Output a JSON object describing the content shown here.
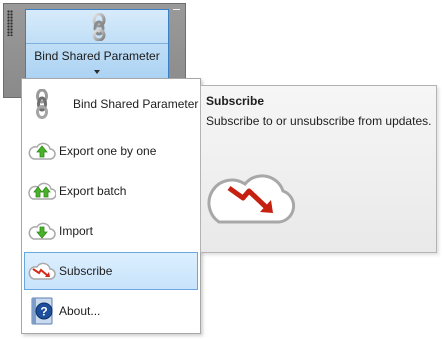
{
  "ribbon": {
    "panel_button": {
      "label": "Bind Shared Parameter",
      "icon": "chain-link-icon"
    }
  },
  "menu": {
    "items": [
      {
        "label": "Bind Shared Parameter",
        "icon": "chain-link-icon"
      },
      {
        "label": "Export one by one",
        "icon": "cloud-upload-icon"
      },
      {
        "label": "Export batch",
        "icon": "cloud-upload-batch-icon"
      },
      {
        "label": "Import",
        "icon": "cloud-download-icon"
      },
      {
        "label": "Subscribe",
        "icon": "cloud-subscribe-icon",
        "selected": true
      },
      {
        "label": "About...",
        "icon": "help-book-icon"
      }
    ]
  },
  "tooltip": {
    "title": "Subscribe",
    "description": "Subscribe to or unsubscribe from updates.",
    "image": "cloud-subscribe-icon"
  },
  "colors": {
    "panel_gray": "#8f8f8f",
    "button_blue": "#bcdcf6",
    "selection_border": "#6aa6e0",
    "cloud_green_arrow": "#4caf2a",
    "subscribe_red": "#d42a1a"
  }
}
